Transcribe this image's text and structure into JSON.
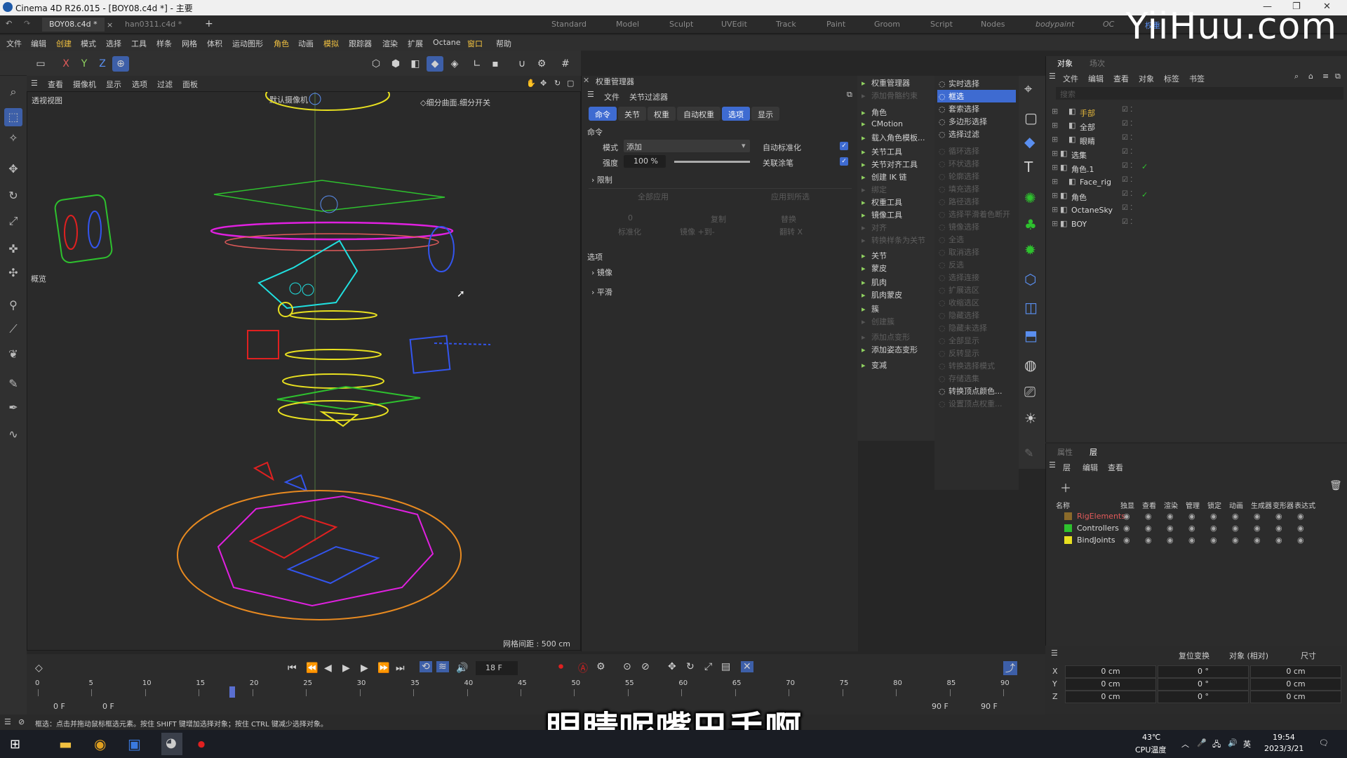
{
  "app": {
    "title": "Cinema 4D R26.015 - [BOY08.c4d *] - 主要",
    "watermark": "YiiHuu.com"
  },
  "doc_tabs": [
    "BOY08.c4d *",
    "han0311.c4d *",
    "+"
  ],
  "layouts": [
    "Standard",
    "Model",
    "Sculpt",
    "UVEdit",
    "Track",
    "Paint",
    "Groom",
    "Script",
    "Nodes",
    "bodypaint",
    "OC",
    "权重"
  ],
  "menus": [
    "文件",
    "编辑",
    "创建",
    "模式",
    "选择",
    "工具",
    "样条",
    "网格",
    "体积",
    "运动图形",
    "角色",
    "动画",
    "模拟",
    "跟踪器",
    "渲染",
    "扩展",
    "Octane",
    "窗口",
    "帮助"
  ],
  "axes": [
    "X",
    "Y",
    "Z"
  ],
  "viewport": {
    "menus": [
      "查看",
      "摄像机",
      "显示",
      "选项",
      "过滤",
      "面板"
    ],
    "name": "透视视图",
    "camera": "默认摄像机",
    "subdiv": "◇细分曲面.细分开关",
    "grid": "网格间距 : 500 cm",
    "overview": "概览"
  },
  "weight_manager": {
    "title": "权重管理器",
    "menus": [
      "文件",
      "关节过滤器"
    ],
    "tabs": [
      "命令",
      "关节",
      "权重",
      "自动权重",
      "选项",
      "显示"
    ],
    "active_tab": "选项",
    "section_cmd": "命令",
    "mode_label": "模式",
    "mode_value": "添加",
    "strength_label": "强度",
    "strength_value": "100 %",
    "strength_fraction": 1.0,
    "auto_normalize": "自动标准化",
    "link_brush": "关联涂笔",
    "limit": "限制",
    "apply_all": "全部应用",
    "apply_selected": "应用到所选",
    "zero": "0",
    "copy": "复制",
    "replace": "替换",
    "normalize": "标准化",
    "mirror_pm": "镜像 +到-",
    "flip_x": "翻转 X",
    "section_options": "选项",
    "mirror": "镜像",
    "smooth": "平滑"
  },
  "char_menu": [
    {
      "t": "权重管理器",
      "on": true
    },
    {
      "t": "添加骨骼约束",
      "on": false
    },
    {
      "t": "角色",
      "on": true
    },
    {
      "t": "CMotion",
      "on": true
    },
    {
      "t": "载入角色模板...",
      "on": true
    },
    {
      "t": "关节工具",
      "on": true
    },
    {
      "t": "关节对齐工具",
      "on": true
    },
    {
      "t": "创建 IK 链",
      "on": true
    },
    {
      "t": "绑定",
      "on": false
    },
    {
      "t": "权重工具",
      "on": true
    },
    {
      "t": "镜像工具",
      "on": true
    },
    {
      "t": "对齐",
      "on": false
    },
    {
      "t": "转换样条为关节",
      "on": false
    },
    {
      "t": "关节",
      "on": true
    },
    {
      "t": "蒙皮",
      "on": true
    },
    {
      "t": "肌肉",
      "on": true
    },
    {
      "t": "肌肉蒙皮",
      "on": true
    },
    {
      "t": "簇",
      "on": true
    },
    {
      "t": "创建簇",
      "on": false
    },
    {
      "t": "添加点变形",
      "on": false
    },
    {
      "t": "添加姿态变形",
      "on": true
    },
    {
      "t": "变减",
      "on": true
    }
  ],
  "select_menu": [
    {
      "t": "实时选择",
      "on": true
    },
    {
      "t": "框选",
      "on": true,
      "active": true
    },
    {
      "t": "套索选择",
      "on": true
    },
    {
      "t": "多边形选择",
      "on": true
    },
    {
      "t": "选择过滤",
      "on": true
    },
    {
      "t": "循环选择",
      "on": false
    },
    {
      "t": "环状选择",
      "on": false
    },
    {
      "t": "轮廓选择",
      "on": false
    },
    {
      "t": "填充选择",
      "on": false
    },
    {
      "t": "路径选择",
      "on": false
    },
    {
      "t": "选择平滑着色断开",
      "on": false
    },
    {
      "t": "镜像选择",
      "on": false
    },
    {
      "t": "全选",
      "on": false
    },
    {
      "t": "取消选择",
      "on": false
    },
    {
      "t": "反选",
      "on": false
    },
    {
      "t": "选择连接",
      "on": false
    },
    {
      "t": "扩展选区",
      "on": false
    },
    {
      "t": "收缩选区",
      "on": false
    },
    {
      "t": "隐藏选择",
      "on": false
    },
    {
      "t": "隐藏未选择",
      "on": false
    },
    {
      "t": "全部显示",
      "on": false
    },
    {
      "t": "反转显示",
      "on": false
    },
    {
      "t": "转换选择模式",
      "on": false
    },
    {
      "t": "存储选集",
      "on": false
    },
    {
      "t": "转换顶点颜色...",
      "on": true
    },
    {
      "t": "设置顶点权重...",
      "on": false
    }
  ],
  "objects": {
    "tabs": [
      "对象",
      "场次"
    ],
    "menus": [
      "文件",
      "编辑",
      "查看",
      "对象",
      "标签",
      "书签"
    ],
    "search": "搜索",
    "rows": [
      {
        "name": "手部",
        "indent": 1,
        "color": "#e3b63a",
        "check": false
      },
      {
        "name": "全部",
        "indent": 1,
        "color": "#d8d8d8",
        "check": false
      },
      {
        "name": "眼睛",
        "indent": 1,
        "color": "#d8d8d8",
        "check": false
      },
      {
        "name": "选集",
        "indent": 0,
        "color": "#d8d8d8",
        "check": false
      },
      {
        "name": "角色.1",
        "indent": 0,
        "color": "#d8d8d8",
        "check": true
      },
      {
        "name": "Face_rig",
        "indent": 1,
        "color": "#d8d8d8",
        "check": false
      },
      {
        "name": "角色",
        "indent": 0,
        "color": "#d8d8d8",
        "check": true
      },
      {
        "name": "OctaneSky",
        "indent": 0,
        "color": "#d8d8d8",
        "check": false
      },
      {
        "name": "BOY",
        "indent": 0,
        "color": "#d8d8d8",
        "check": false
      }
    ]
  },
  "layers": {
    "tabs": [
      "属性",
      "层"
    ],
    "menus": [
      "层",
      "编辑",
      "查看"
    ],
    "cols": [
      "名称",
      "独显",
      "查看",
      "渲染",
      "管理",
      "锁定",
      "动画",
      "生成器",
      "变形器",
      "表达式"
    ],
    "rows": [
      {
        "name": "RigElements",
        "color": "#8a6a2a",
        "text": "#e05a5a"
      },
      {
        "name": "Controllers",
        "color": "#2ec12e",
        "text": "#d8d8d8"
      },
      {
        "name": "BindJoints",
        "color": "#e8e020",
        "text": "#d8d8d8"
      }
    ]
  },
  "coords": {
    "reset": "复位变换",
    "mode": "对象 (相对)",
    "size": "尺寸",
    "rows": [
      {
        "axis": "X",
        "p": "0 cm",
        "r": "0 °",
        "s": "0 cm"
      },
      {
        "axis": "Y",
        "p": "0 cm",
        "r": "0 °",
        "s": "0 cm"
      },
      {
        "axis": "Z",
        "p": "0 cm",
        "r": "0 °",
        "s": "0 cm"
      }
    ]
  },
  "timeline": {
    "frame": "18 F",
    "current": 18,
    "start": "0 F",
    "start2": "0 F",
    "end": "90 F",
    "end2": "90 F",
    "max": 90,
    "ticks": [
      "0",
      "5",
      "10",
      "15",
      "20",
      "25",
      "30",
      "35",
      "40",
      "45",
      "50",
      "55",
      "60",
      "65",
      "70",
      "75",
      "80",
      "85",
      "90"
    ]
  },
  "status": "框选：点击并拖动鼠标框选元素。按住 SHIFT 键增加选择对象；按住 CTRL 键减少选择对象。",
  "subtitle": "眼睛呢嘴巴手啊",
  "taskbar": {
    "temp": "43℃",
    "temp_label": "CPU温度",
    "ime": "英",
    "time": "19:54",
    "date": "2023/3/21"
  }
}
